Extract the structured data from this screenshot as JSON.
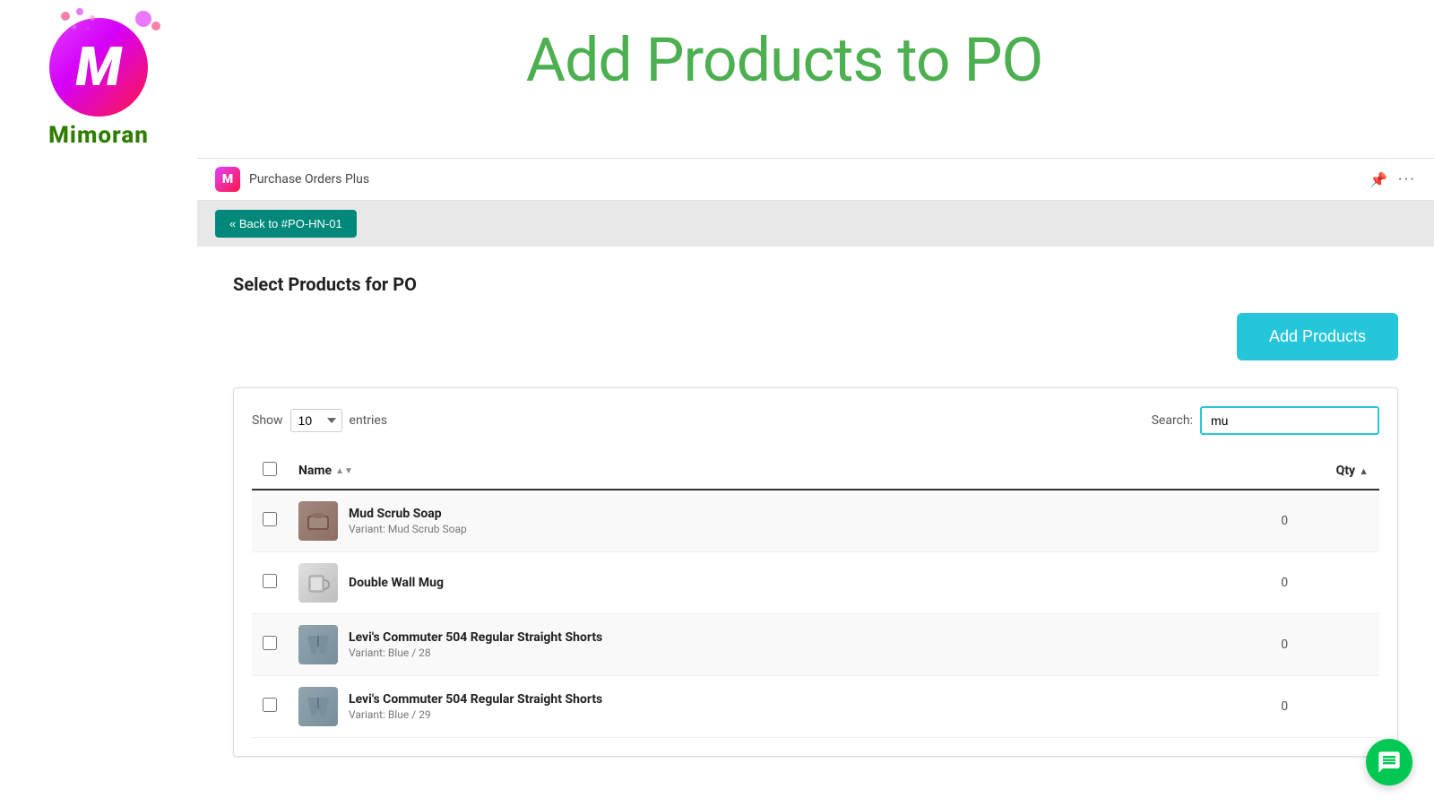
{
  "logo": {
    "letter": "M",
    "brand_name": "Mimoran"
  },
  "page_title": "Add Products to PO",
  "app_bar": {
    "app_name": "Purchase Orders Plus",
    "pin_icon": "📌",
    "more_icon": "···"
  },
  "sub_bar": {
    "back_button_label": "« Back to #PO-HN-01"
  },
  "main": {
    "section_title": "Select Products for PO",
    "add_products_button": "Add Products",
    "table": {
      "show_label": "Show",
      "entries_value": "10",
      "entries_label": "entries",
      "search_label": "Search:",
      "search_value": "mu",
      "columns": [
        {
          "id": "checkbox",
          "label": ""
        },
        {
          "id": "name",
          "label": "Name"
        },
        {
          "id": "qty",
          "label": "Qty"
        }
      ],
      "rows": [
        {
          "id": 1,
          "name": "Mud Scrub Soap",
          "variant": "Variant: Mud Scrub Soap",
          "qty": 0,
          "thumb_type": "mud"
        },
        {
          "id": 2,
          "name": "Double Wall Mug",
          "variant": "",
          "qty": 0,
          "thumb_type": "mug"
        },
        {
          "id": 3,
          "name": "Levi's Commuter 504 Regular Straight Shorts",
          "variant": "Variant: Blue / 28",
          "qty": 0,
          "thumb_type": "shorts"
        },
        {
          "id": 4,
          "name": "Levi's Commuter 504 Regular Straight Shorts",
          "variant": "Variant: Blue / 29",
          "qty": 0,
          "thumb_type": "shorts"
        }
      ]
    }
  }
}
